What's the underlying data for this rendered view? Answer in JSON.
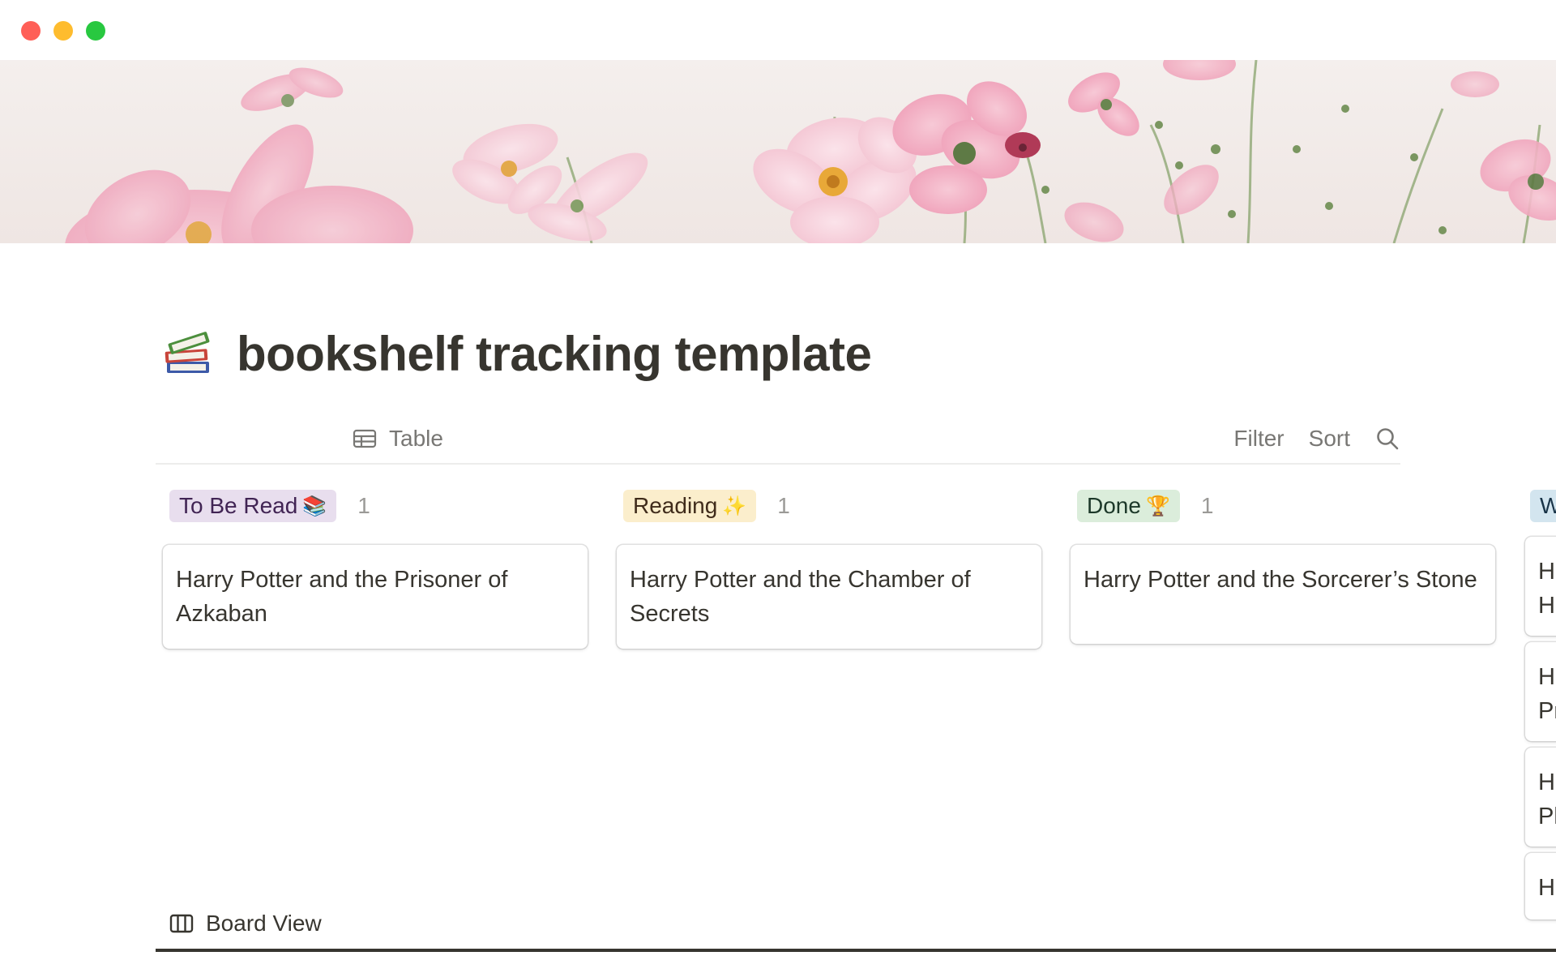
{
  "page": {
    "title": "bookshelf tracking template",
    "icon": "books-icon"
  },
  "views": {
    "board_label": "Board View",
    "table_label": "Table",
    "filter_label": "Filter",
    "sort_label": "Sort"
  },
  "board": {
    "columns": [
      {
        "label": "To Be Read",
        "emoji": "📚",
        "count": "1",
        "color": "#e8deee",
        "cards": [
          "Harry Potter and the Prisoner of Azkaban"
        ]
      },
      {
        "label": "Reading",
        "emoji": "✨",
        "count": "1",
        "color": "#fbeecc",
        "cards": [
          "Harry Potter and the Chamber of Secrets"
        ]
      },
      {
        "label": "Done",
        "emoji": "🏆",
        "count": "1",
        "color": "#dbeddb",
        "cards": [
          "Harry Potter and the Sorcerer’s Stone"
        ]
      },
      {
        "label": "W",
        "color": "#d3e5ef",
        "cards": [
          "H\nH",
          "H\nPr",
          "H\nPl",
          "H"
        ]
      }
    ]
  }
}
